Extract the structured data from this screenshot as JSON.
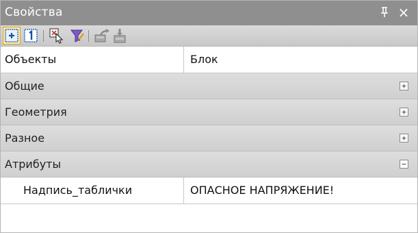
{
  "window": {
    "title": "Свойства",
    "pin_glyph": "ᵖ",
    "close_glyph": "×"
  },
  "toolbar": {
    "tools": [
      {
        "name": "toggle-view-icon",
        "active": true
      },
      {
        "name": "numbered-list-icon",
        "active": false
      },
      {
        "name": "select-objects-icon",
        "active": false
      },
      {
        "name": "filter-icon",
        "active": false
      },
      {
        "name": "export-icon",
        "active": false
      },
      {
        "name": "import-icon",
        "active": false
      }
    ]
  },
  "grid": {
    "objects_row": {
      "label": "Объекты",
      "value": "Блок"
    },
    "categories": [
      {
        "label": "Общие",
        "expander": "+"
      },
      {
        "label": "Геометрия",
        "expander": "+"
      },
      {
        "label": "Разное",
        "expander": "+"
      },
      {
        "label": "Атрибуты",
        "expander": "−"
      }
    ],
    "attribute_row": {
      "label": "Надпись_таблички",
      "value": "ОПАСНОЕ НАПРЯЖЕНИЕ!"
    }
  },
  "colors": {
    "titlebar": "#8f8f8f",
    "toolbar": "#d0d0d0",
    "category": "#d6d6d6",
    "active_tool": "#fde9a6"
  }
}
